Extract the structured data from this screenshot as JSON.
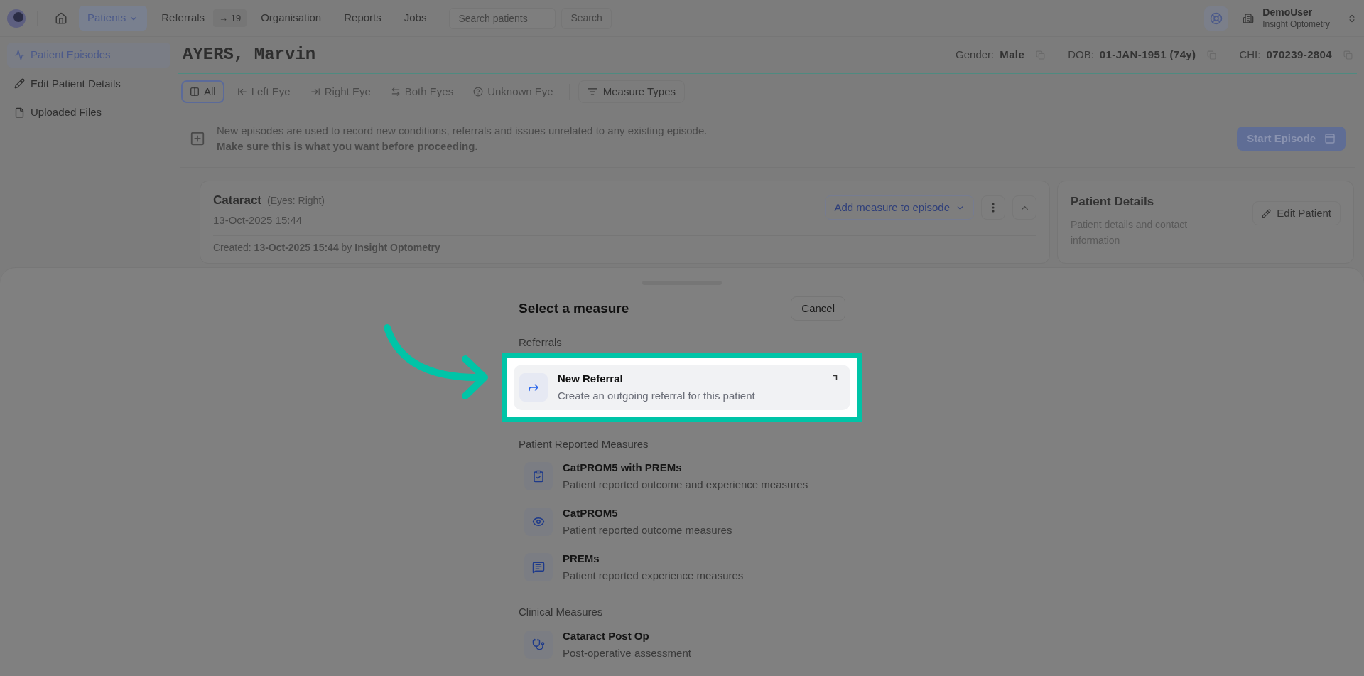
{
  "nav": {
    "items": [
      {
        "label": "Patients",
        "selected": true,
        "kind": "dropdown"
      },
      {
        "label": "Referrals",
        "selected": false,
        "badge": "→ 19"
      },
      {
        "label": "Organisation",
        "selected": false
      },
      {
        "label": "Reports",
        "selected": false
      },
      {
        "label": "Jobs",
        "selected": false
      }
    ],
    "search": {
      "placeholder": "Search patients"
    },
    "search_button": "Search",
    "user": {
      "name": "DemoUser",
      "org": "Insight Optometry"
    }
  },
  "sidebar": {
    "items": [
      {
        "label": "Patient Episodes",
        "selected": true,
        "kind": "activity"
      },
      {
        "label": "Edit Patient Details",
        "selected": false,
        "kind": "edit"
      },
      {
        "label": "Uploaded Files",
        "selected": false,
        "kind": "file"
      }
    ]
  },
  "patient": {
    "name": "AYERS, Marvin",
    "fields": [
      {
        "label": "Gender:",
        "value": "Male"
      },
      {
        "label": "DOB:",
        "value": "01-JAN-1951 (74y)"
      },
      {
        "label": "CHI:",
        "value": "070239-2804"
      }
    ]
  },
  "filters": {
    "items": [
      {
        "label": "All",
        "selected": true,
        "kind": "all"
      },
      {
        "label": "Left Eye",
        "selected": false,
        "kind": "left"
      },
      {
        "label": "Right Eye",
        "selected": false,
        "kind": "right"
      },
      {
        "label": "Both Eyes",
        "selected": false,
        "kind": "both"
      },
      {
        "label": "Unknown Eye",
        "selected": false,
        "kind": "unknown"
      }
    ],
    "measure_types": "Measure Types"
  },
  "notice": {
    "lines": [
      "New episodes are used to record new conditions, referrals and issues unrelated to any existing episode.",
      "Make sure this is what you want before proceeding."
    ],
    "button": "Start Episode"
  },
  "episode": {
    "title": "Cataract",
    "eyes": "(Eyes: Right)",
    "date": "13-Oct-2025 15:44",
    "add_button": "Add measure to episode",
    "created": "Created: **13-Oct-2025 15:44** by **Insight Optometry**"
  },
  "patient_details": {
    "title": "Patient Details",
    "description": "Patient details and contact information",
    "button": "Edit Patient"
  },
  "sheet": {
    "title": "Select a measure",
    "cancel": "Cancel",
    "sections": [
      {
        "title": "Referrals",
        "items": [
          {
            "title": "New Referral",
            "description": "Create an outgoing referral for this patient",
            "kind": "referral",
            "highlighted": true
          }
        ]
      },
      {
        "title": "Patient Reported Measures",
        "items": [
          {
            "title": "CatPROM5 with PREMs",
            "description": "Patient reported outcome and experience measures",
            "kind": "clipboard",
            "highlighted": false
          },
          {
            "title": "CatPROM5",
            "description": "Patient reported outcome measures",
            "kind": "eye",
            "highlighted": false
          },
          {
            "title": "PREMs",
            "description": "Patient reported experience measures",
            "kind": "message",
            "highlighted": false
          }
        ]
      },
      {
        "title": "Clinical Measures",
        "items": [
          {
            "title": "Cataract Post Op",
            "description": "Post-operative assessment",
            "kind": "stethoscope",
            "highlighted": false
          }
        ]
      }
    ]
  }
}
